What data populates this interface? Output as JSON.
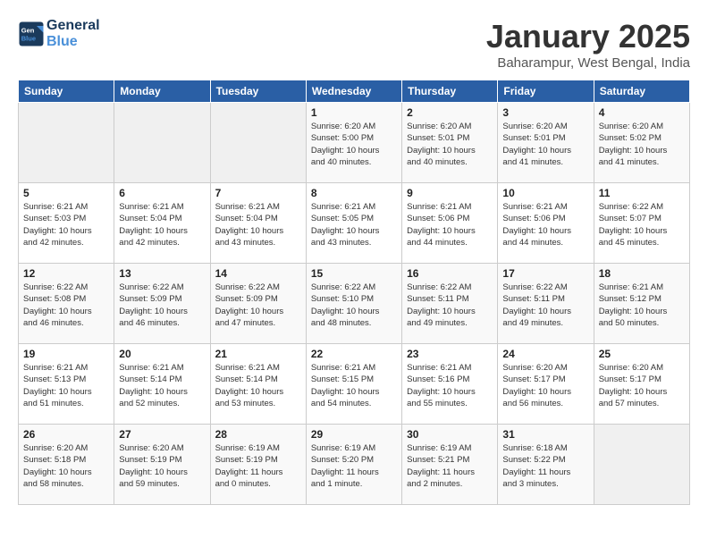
{
  "header": {
    "logo_line1": "General",
    "logo_line2": "Blue",
    "month_title": "January 2025",
    "location": "Baharampur, West Bengal, India"
  },
  "weekdays": [
    "Sunday",
    "Monday",
    "Tuesday",
    "Wednesday",
    "Thursday",
    "Friday",
    "Saturday"
  ],
  "weeks": [
    [
      {
        "day": "",
        "info": ""
      },
      {
        "day": "",
        "info": ""
      },
      {
        "day": "",
        "info": ""
      },
      {
        "day": "1",
        "info": "Sunrise: 6:20 AM\nSunset: 5:00 PM\nDaylight: 10 hours\nand 40 minutes."
      },
      {
        "day": "2",
        "info": "Sunrise: 6:20 AM\nSunset: 5:01 PM\nDaylight: 10 hours\nand 40 minutes."
      },
      {
        "day": "3",
        "info": "Sunrise: 6:20 AM\nSunset: 5:01 PM\nDaylight: 10 hours\nand 41 minutes."
      },
      {
        "day": "4",
        "info": "Sunrise: 6:20 AM\nSunset: 5:02 PM\nDaylight: 10 hours\nand 41 minutes."
      }
    ],
    [
      {
        "day": "5",
        "info": "Sunrise: 6:21 AM\nSunset: 5:03 PM\nDaylight: 10 hours\nand 42 minutes."
      },
      {
        "day": "6",
        "info": "Sunrise: 6:21 AM\nSunset: 5:04 PM\nDaylight: 10 hours\nand 42 minutes."
      },
      {
        "day": "7",
        "info": "Sunrise: 6:21 AM\nSunset: 5:04 PM\nDaylight: 10 hours\nand 43 minutes."
      },
      {
        "day": "8",
        "info": "Sunrise: 6:21 AM\nSunset: 5:05 PM\nDaylight: 10 hours\nand 43 minutes."
      },
      {
        "day": "9",
        "info": "Sunrise: 6:21 AM\nSunset: 5:06 PM\nDaylight: 10 hours\nand 44 minutes."
      },
      {
        "day": "10",
        "info": "Sunrise: 6:21 AM\nSunset: 5:06 PM\nDaylight: 10 hours\nand 44 minutes."
      },
      {
        "day": "11",
        "info": "Sunrise: 6:22 AM\nSunset: 5:07 PM\nDaylight: 10 hours\nand 45 minutes."
      }
    ],
    [
      {
        "day": "12",
        "info": "Sunrise: 6:22 AM\nSunset: 5:08 PM\nDaylight: 10 hours\nand 46 minutes."
      },
      {
        "day": "13",
        "info": "Sunrise: 6:22 AM\nSunset: 5:09 PM\nDaylight: 10 hours\nand 46 minutes."
      },
      {
        "day": "14",
        "info": "Sunrise: 6:22 AM\nSunset: 5:09 PM\nDaylight: 10 hours\nand 47 minutes."
      },
      {
        "day": "15",
        "info": "Sunrise: 6:22 AM\nSunset: 5:10 PM\nDaylight: 10 hours\nand 48 minutes."
      },
      {
        "day": "16",
        "info": "Sunrise: 6:22 AM\nSunset: 5:11 PM\nDaylight: 10 hours\nand 49 minutes."
      },
      {
        "day": "17",
        "info": "Sunrise: 6:22 AM\nSunset: 5:11 PM\nDaylight: 10 hours\nand 49 minutes."
      },
      {
        "day": "18",
        "info": "Sunrise: 6:21 AM\nSunset: 5:12 PM\nDaylight: 10 hours\nand 50 minutes."
      }
    ],
    [
      {
        "day": "19",
        "info": "Sunrise: 6:21 AM\nSunset: 5:13 PM\nDaylight: 10 hours\nand 51 minutes."
      },
      {
        "day": "20",
        "info": "Sunrise: 6:21 AM\nSunset: 5:14 PM\nDaylight: 10 hours\nand 52 minutes."
      },
      {
        "day": "21",
        "info": "Sunrise: 6:21 AM\nSunset: 5:14 PM\nDaylight: 10 hours\nand 53 minutes."
      },
      {
        "day": "22",
        "info": "Sunrise: 6:21 AM\nSunset: 5:15 PM\nDaylight: 10 hours\nand 54 minutes."
      },
      {
        "day": "23",
        "info": "Sunrise: 6:21 AM\nSunset: 5:16 PM\nDaylight: 10 hours\nand 55 minutes."
      },
      {
        "day": "24",
        "info": "Sunrise: 6:20 AM\nSunset: 5:17 PM\nDaylight: 10 hours\nand 56 minutes."
      },
      {
        "day": "25",
        "info": "Sunrise: 6:20 AM\nSunset: 5:17 PM\nDaylight: 10 hours\nand 57 minutes."
      }
    ],
    [
      {
        "day": "26",
        "info": "Sunrise: 6:20 AM\nSunset: 5:18 PM\nDaylight: 10 hours\nand 58 minutes."
      },
      {
        "day": "27",
        "info": "Sunrise: 6:20 AM\nSunset: 5:19 PM\nDaylight: 10 hours\nand 59 minutes."
      },
      {
        "day": "28",
        "info": "Sunrise: 6:19 AM\nSunset: 5:19 PM\nDaylight: 11 hours\nand 0 minutes."
      },
      {
        "day": "29",
        "info": "Sunrise: 6:19 AM\nSunset: 5:20 PM\nDaylight: 11 hours\nand 1 minute."
      },
      {
        "day": "30",
        "info": "Sunrise: 6:19 AM\nSunset: 5:21 PM\nDaylight: 11 hours\nand 2 minutes."
      },
      {
        "day": "31",
        "info": "Sunrise: 6:18 AM\nSunset: 5:22 PM\nDaylight: 11 hours\nand 3 minutes."
      },
      {
        "day": "",
        "info": ""
      }
    ]
  ]
}
